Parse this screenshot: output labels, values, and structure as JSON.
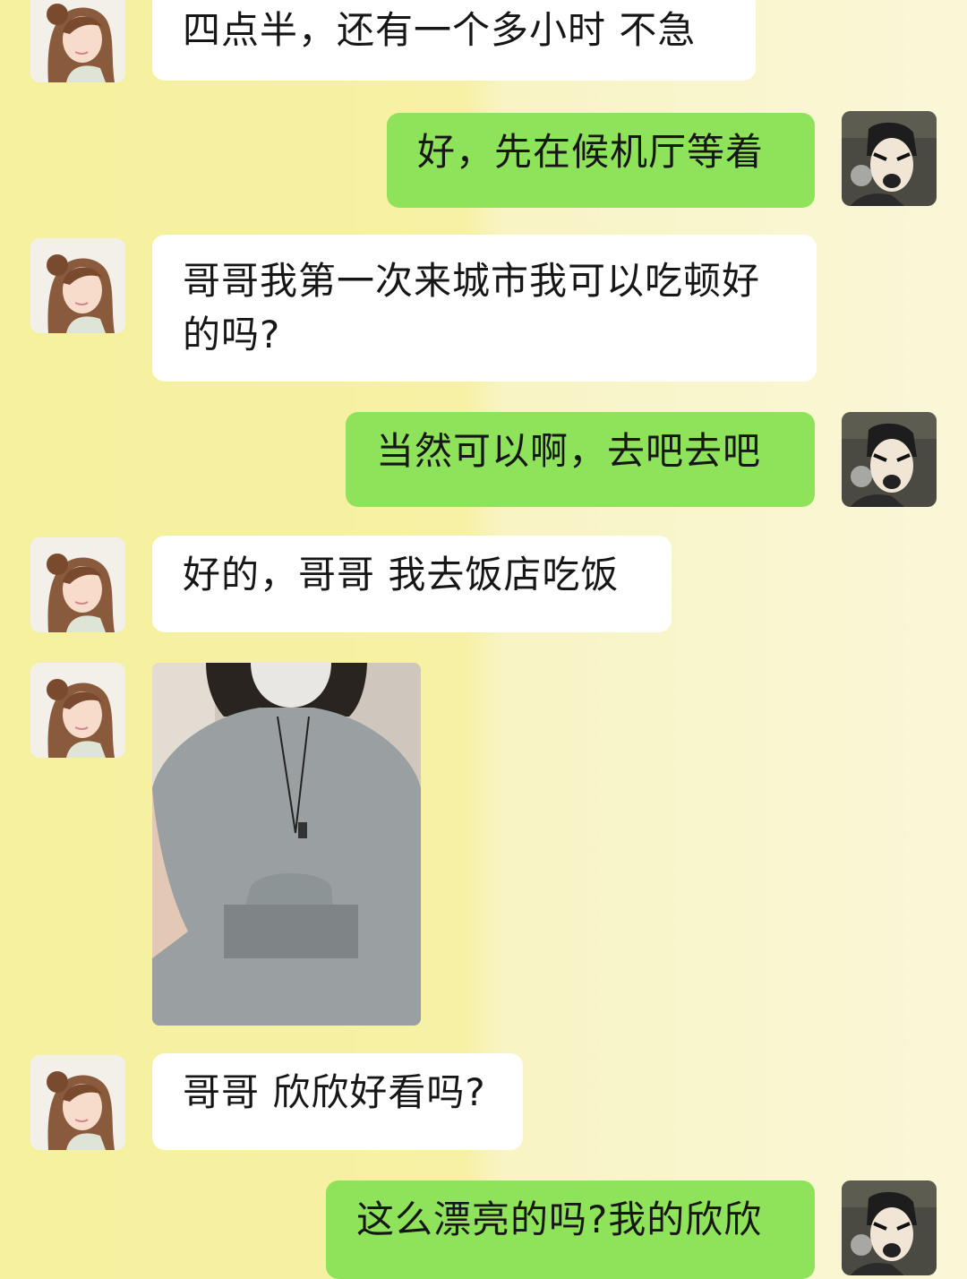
{
  "messages": [
    {
      "side": "left",
      "text": "四点半，还有一个多小时 不急"
    },
    {
      "side": "right",
      "text": "好，先在候机厅等着"
    },
    {
      "side": "left",
      "text_line1": "哥哥我第一次来城市我可以吃顿好",
      "text_line2": "的吗?"
    },
    {
      "side": "right",
      "text": "当然可以啊，去吧去吧"
    },
    {
      "side": "left",
      "text": "好的，哥哥 我去饭店吃饭"
    },
    {
      "side": "left",
      "type": "image",
      "image": "photo of woman in grey top wearing face mask"
    },
    {
      "side": "left",
      "text": "哥哥 欣欣好看吗?"
    },
    {
      "side": "right",
      "text": "这么漂亮的吗?我的欣欣"
    }
  ],
  "avatars": {
    "left": "cartoon-girl-avatar",
    "right": "cartoon-man-avatar"
  },
  "colors": {
    "left_bubble": "#ffffff",
    "right_bubble": "#8fe35a",
    "background": "#f6f1a4"
  }
}
